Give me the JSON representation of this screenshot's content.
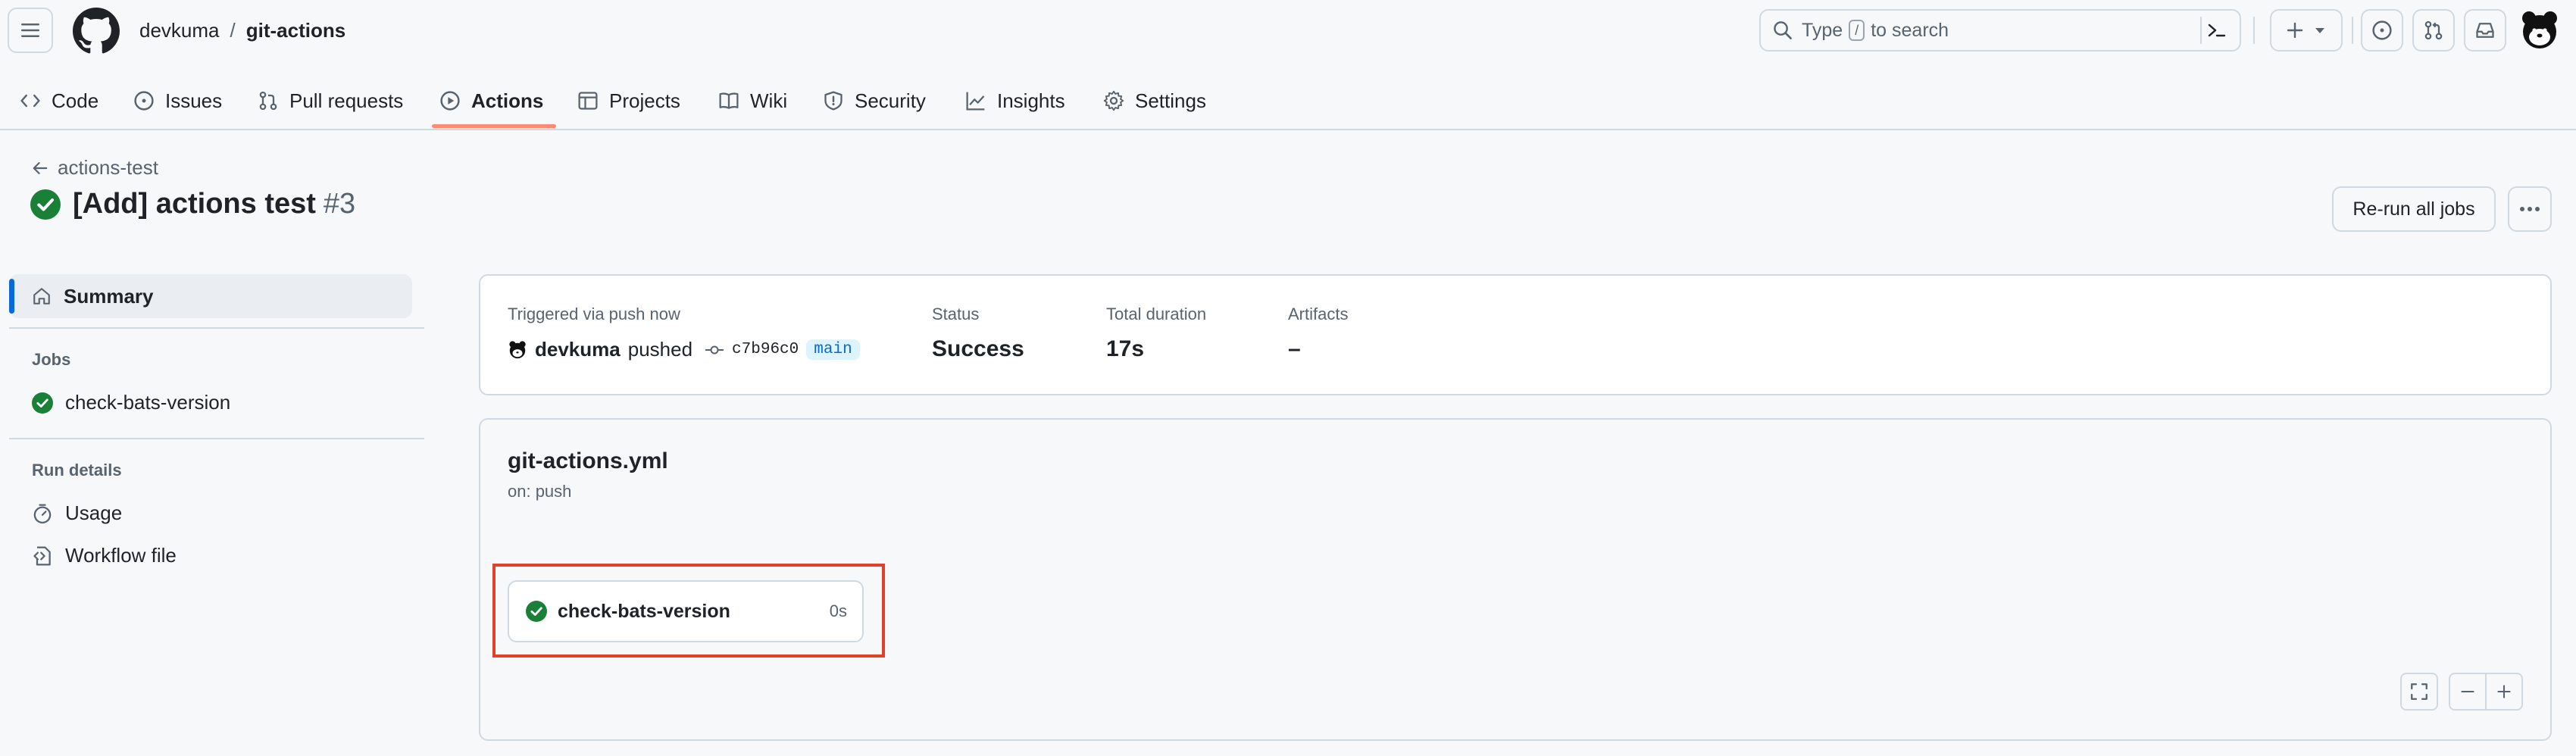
{
  "header": {
    "owner": "devkuma",
    "separator": "/",
    "repo": "git-actions",
    "search": {
      "prefix": "Type",
      "slash_key": "/",
      "suffix": "to search"
    }
  },
  "tabs": [
    {
      "label": "Code",
      "icon": "code-icon"
    },
    {
      "label": "Issues",
      "icon": "issue-opened-icon"
    },
    {
      "label": "Pull requests",
      "icon": "git-pull-request-icon"
    },
    {
      "label": "Actions",
      "icon": "play-icon",
      "active": true
    },
    {
      "label": "Projects",
      "icon": "table-icon"
    },
    {
      "label": "Wiki",
      "icon": "book-icon"
    },
    {
      "label": "Security",
      "icon": "shield-icon"
    },
    {
      "label": "Insights",
      "icon": "graph-icon"
    },
    {
      "label": "Settings",
      "icon": "gear-icon"
    }
  ],
  "page": {
    "back_label": "actions-test",
    "title": "[Add] actions test",
    "run_number": "#3",
    "status_color": "#1a7f37",
    "rerun_label": "Re-run all jobs"
  },
  "sidebar": {
    "summary_label": "Summary",
    "jobs_heading": "Jobs",
    "jobs": [
      {
        "label": "check-bats-version",
        "status": "success"
      }
    ],
    "run_details_heading": "Run details",
    "run_details": [
      {
        "label": "Usage",
        "icon": "stopwatch-icon"
      },
      {
        "label": "Workflow file",
        "icon": "file-code-icon"
      }
    ]
  },
  "summary": {
    "trigger_label": "Triggered via push now",
    "actor": "devkuma",
    "action": "pushed",
    "commit_sha": "c7b96c0",
    "branch": "main",
    "status_label": "Status",
    "status_value": "Success",
    "duration_label": "Total duration",
    "duration_value": "17s",
    "artifacts_label": "Artifacts",
    "artifacts_value": "–"
  },
  "workflow": {
    "file_name": "git-actions.yml",
    "trigger": "on: push",
    "jobs": [
      {
        "name": "check-bats-version",
        "duration": "0s",
        "status": "success"
      }
    ]
  },
  "colors": {
    "accent": "#0969da",
    "success": "#1a7f37",
    "active_tab_underline": "#fd8c73",
    "highlight": "#e0412b"
  }
}
